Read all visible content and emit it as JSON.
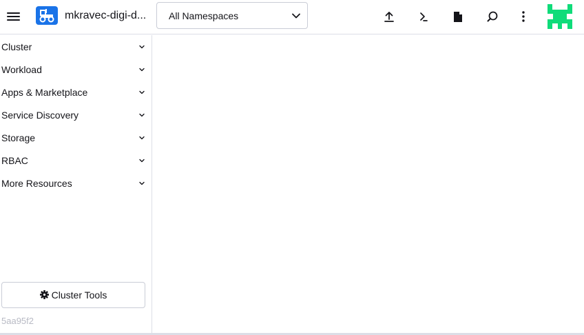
{
  "header": {
    "menu_icon": "hamburger-icon",
    "cluster_icon": "tractor-icon",
    "cluster_name": "mkravec-digi-d...",
    "namespace_selected": "All Namespaces",
    "actions": [
      {
        "name": "import-yaml",
        "icon": "upload-icon"
      },
      {
        "name": "kubectl-shell",
        "icon": "terminal-icon"
      },
      {
        "name": "kubeconfig",
        "icon": "file-icon"
      },
      {
        "name": "resource-search",
        "icon": "search-icon"
      },
      {
        "name": "more-actions",
        "icon": "more-vertical-icon"
      }
    ],
    "logo_color": "#0fdc7a",
    "accent": "#1a73e8"
  },
  "sidebar": {
    "items": [
      {
        "label": "Cluster"
      },
      {
        "label": "Workload"
      },
      {
        "label": "Apps & Marketplace"
      },
      {
        "label": "Service Discovery"
      },
      {
        "label": "Storage"
      },
      {
        "label": "RBAC"
      },
      {
        "label": "More Resources"
      }
    ],
    "cluster_tools_label": "Cluster Tools",
    "version": "5aa95f2"
  }
}
